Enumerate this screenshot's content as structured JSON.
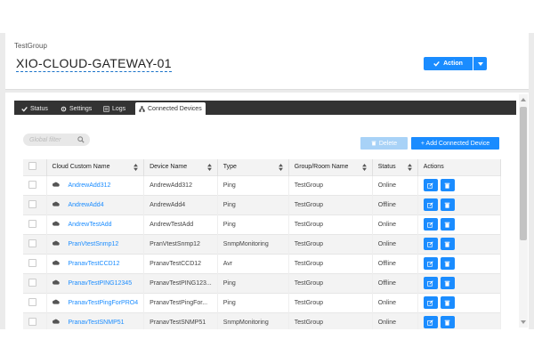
{
  "header": {
    "group_label": "TestGroup",
    "device_title": "XIO-CLOUD-GATEWAY-01",
    "action_label": "Action"
  },
  "tabs": [
    {
      "label": "Status",
      "icon": "check-icon",
      "active": false
    },
    {
      "label": "Settings",
      "icon": "gear-icon",
      "active": false
    },
    {
      "label": "Logs",
      "icon": "list-icon",
      "active": false
    },
    {
      "label": "Connected Devices",
      "icon": "sitemap-icon",
      "active": true
    }
  ],
  "toolbar": {
    "filter_placeholder": "Global filter",
    "delete_label": "Delete",
    "add_label": "+ Add Connected Device"
  },
  "table": {
    "columns": [
      "Cloud Custom Name",
      "Device Name",
      "Type",
      "Group/Room Name",
      "Status",
      "Actions"
    ],
    "rows": [
      {
        "cloud_name": "AndrewAdd312",
        "device_name": "AndrewAdd312",
        "type": "Ping",
        "group": "TestGroup",
        "status": "Online"
      },
      {
        "cloud_name": "AndrewAdd4",
        "device_name": "AndrewAdd4",
        "type": "Ping",
        "group": "TestGroup",
        "status": "Offline"
      },
      {
        "cloud_name": "AndrewTestAdd",
        "device_name": "AndrewTestAdd",
        "type": "Ping",
        "group": "TestGroup",
        "status": "Online"
      },
      {
        "cloud_name": "PranVtestSnmp12",
        "device_name": "PranVtestSnmp12",
        "type": "SnmpMonitoring",
        "group": "TestGroup",
        "status": "Online"
      },
      {
        "cloud_name": "PranavTestCCD12",
        "device_name": "PranavTestCCD12",
        "type": "Avr",
        "group": "TestGroup",
        "status": "Offline"
      },
      {
        "cloud_name": "PranavTestPING12345",
        "device_name": "PranavTestPING123...",
        "type": "Ping",
        "group": "TestGroup",
        "status": "Offline"
      },
      {
        "cloud_name": "PranavTestPingForPRO4",
        "device_name": "PranavTestPingFor...",
        "type": "Ping",
        "group": "TestGroup",
        "status": "Online"
      },
      {
        "cloud_name": "PranavTestSNMP51",
        "device_name": "PranavTestSNMP51",
        "type": "SnmpMonitoring",
        "group": "TestGroup",
        "status": "Online"
      }
    ]
  },
  "colors": {
    "accent": "#1a8cff",
    "online": "#2e8b2e",
    "offline": "#d32f2f",
    "tab_bar": "#333333"
  }
}
